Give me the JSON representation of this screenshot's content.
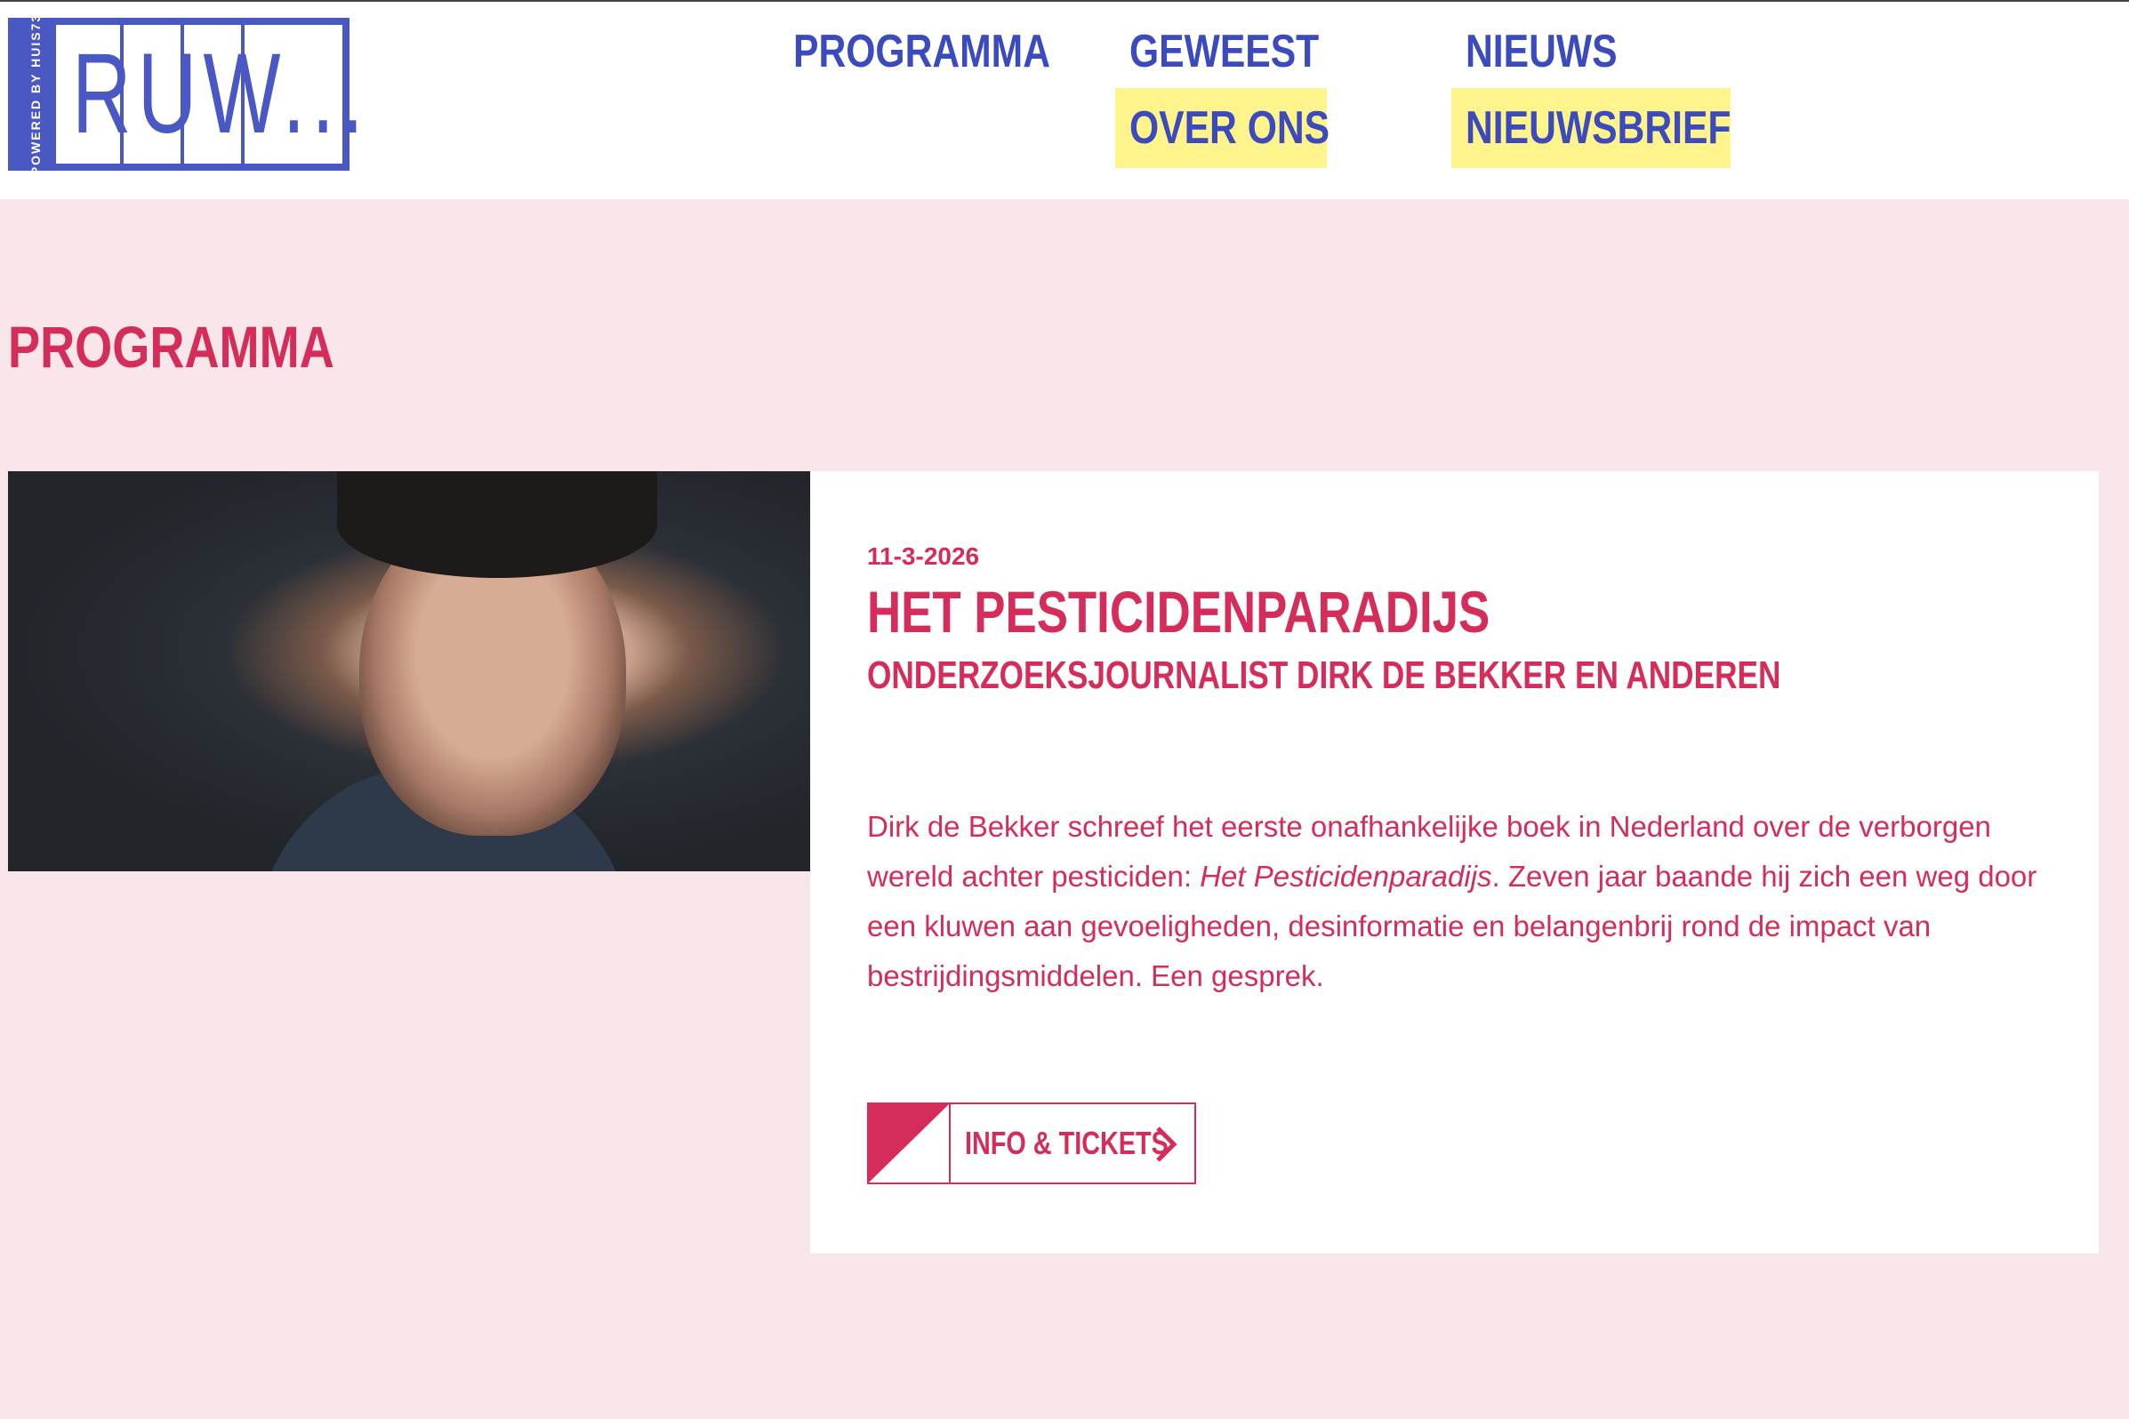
{
  "header": {
    "logo": {
      "strip_text": "POWERED BY HUIS73",
      "word": "RUW..."
    },
    "nav": [
      {
        "label": "PROGRAMMA"
      },
      {
        "label": "GEWEEST"
      },
      {
        "label": "NIEUWS"
      }
    ],
    "nav_highlighted": [
      {
        "label": "OVER ONS"
      },
      {
        "label": "NIEUWSBRIEF"
      }
    ]
  },
  "page": {
    "title": "PROGRAMMA"
  },
  "event": {
    "date": "11-3-2026",
    "title": "HET PESTICIDENPARADIJS",
    "subtitle": "ONDERZOEKSJOURNALIST DIRK DE BEKKER EN ANDEREN",
    "body_1": "Dirk de Bekker schreef het eerste onafhankelijke boek in Nederland over de verborgen wereld achter pesticiden: ",
    "body_italic": "Het Pesticidenparadijs",
    "body_2": ". Zeven jaar baande hij zich een weg door een kluwen aan gevoeligheden, desinformatie en belangenbrij rond de impact van bestrijdingsmiddelen. Een gesprek.",
    "button_label": "INFO & TICKETS"
  },
  "colors": {
    "brand_blue": "#4a58c4",
    "accent_pink": "#d42d5a",
    "highlight_yellow": "#fff48c",
    "page_background": "#f9e6ea"
  },
  "icons": {
    "button_icon": "chevron-right-icon"
  }
}
